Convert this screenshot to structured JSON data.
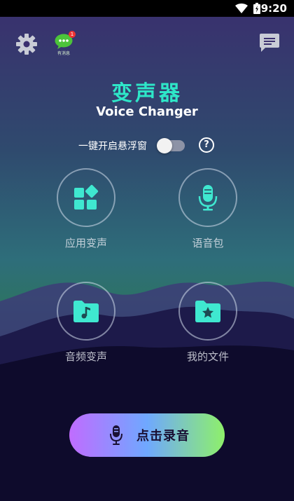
{
  "status_bar": {
    "time": "9:20"
  },
  "header": {
    "chat_badge_count": "1",
    "chat_badge_tag": "有消息"
  },
  "title": {
    "cn": "变声器",
    "en": "Voice Changer"
  },
  "float_window": {
    "label": "一键开启悬浮窗",
    "enabled": false,
    "help": "?"
  },
  "features": [
    {
      "label": "应用变声",
      "icon": "apps-icon"
    },
    {
      "label": "语音包",
      "icon": "microphone-icon"
    },
    {
      "label": "音频变声",
      "icon": "music-folder-icon"
    },
    {
      "label": "我的文件",
      "icon": "star-folder-icon"
    }
  ],
  "record_button": {
    "label": "点击录音"
  },
  "colors": {
    "accent": "#2ee6c8",
    "icon_teal": "#3fe8d0",
    "toggle_off": "#8d93a6"
  }
}
